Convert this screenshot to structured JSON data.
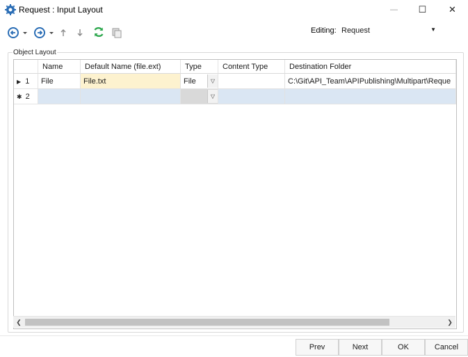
{
  "window": {
    "title": "Request : Input Layout",
    "minimize_glyph": "—",
    "maximize_glyph": "☐",
    "close_glyph": "✕"
  },
  "toolbar": {
    "editing_label": "Editing:",
    "editing_value": "Request",
    "icons": [
      "back-icon",
      "dropdown-arrow-icon",
      "forward-icon",
      "dropdown-arrow-icon",
      "move-up-icon",
      "move-down-icon",
      "refresh-icon",
      "copy-icon"
    ]
  },
  "group": {
    "label": "Object Layout"
  },
  "grid": {
    "columns": [
      "Name",
      "Default Name (file.ext)",
      "Type",
      "Content Type",
      "Destination Folder"
    ],
    "rows": [
      {
        "marker": "▶",
        "index": "1",
        "name": "File",
        "default_name": "File.txt",
        "type": "File",
        "content_type": "",
        "destination": "C:\\Git\\API_Team\\APIPublishing\\Multipart\\Reque"
      },
      {
        "marker": "✱",
        "index": "2",
        "name": "",
        "default_name": "",
        "type": "",
        "content_type": "",
        "destination": ""
      }
    ]
  },
  "buttons": {
    "prev": "Prev",
    "next": "Next",
    "ok": "OK",
    "cancel": "Cancel"
  },
  "colors": {
    "accent": "#2a6db5",
    "refresh_green": "#2fa84f",
    "selected_row": "#dae6f3",
    "edit_cell": "#fdf2cf"
  }
}
